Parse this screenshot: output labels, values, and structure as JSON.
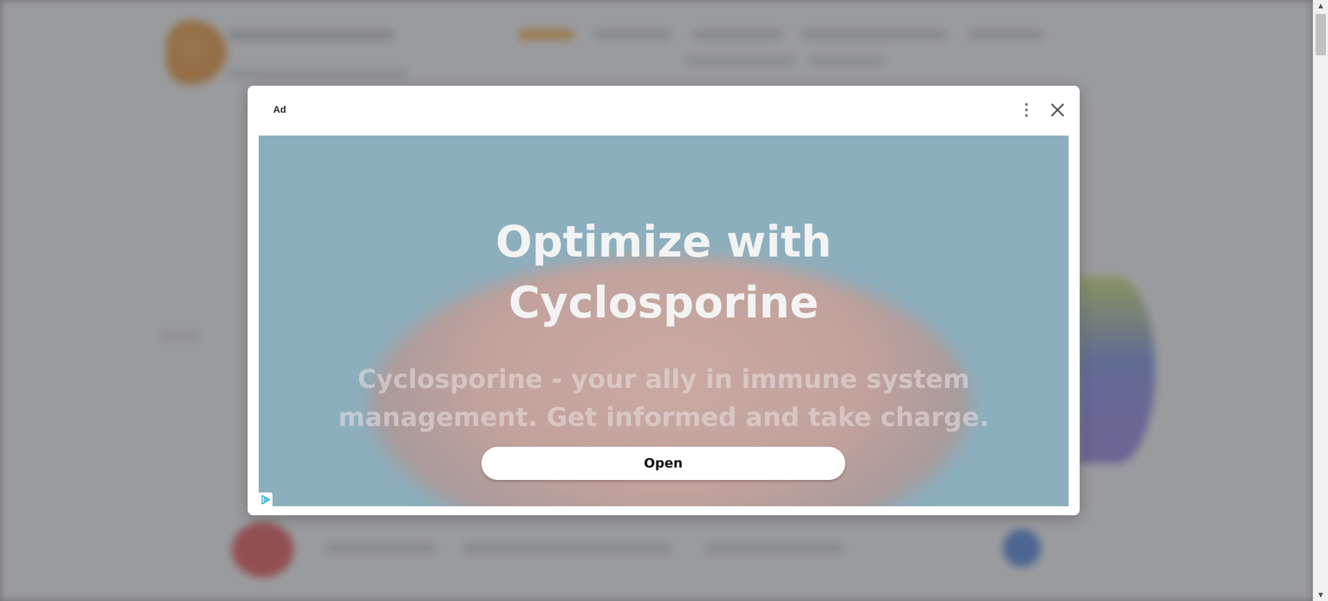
{
  "ad": {
    "label": "Ad",
    "headline_line1": "Optimize with",
    "headline_line2": "Cyclosporine",
    "subline_line1": "Cyclosporine - your ally in immune system",
    "subline_line2": "management. Get informed and take charge.",
    "cta_label": "Open",
    "icons": {
      "menu": "more-vertical-icon",
      "close": "close-icon",
      "adchoices": "adchoices-icon"
    }
  },
  "colors": {
    "creative_background": "#8cafbe",
    "overlay": "rgba(80,82,88,0.55)",
    "cta_background": "#ffffff"
  }
}
